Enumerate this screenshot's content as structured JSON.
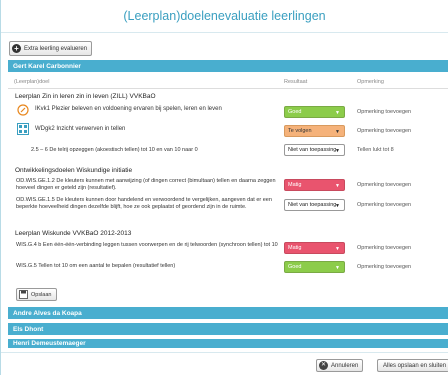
{
  "title": "(Leerplan)doelenevaluatie leerlingen",
  "extra_button": "Extra leerling evalueren",
  "students": [
    "Gert Karel Carbonnier",
    "Andre Alves da Koapa",
    "Els Dhont",
    "Henri Demeustemaeger"
  ],
  "columns": {
    "goal": "(Leerplan)doel",
    "result": "Resultaat",
    "remark": "Opmerking"
  },
  "section1": {
    "title": "Leerplan Zin in leren zin in leven (ZILL) VVKBaO",
    "item1": "IKvk1 Plezier beleven en voldoening ervaren bij spelen, leren en leven",
    "item1_result": "Goed",
    "item1_remark": "Opmerking toevoegen",
    "item2": "WDgk2 Inzicht verwerven in tellen",
    "item2_result": "Te volgen",
    "item2_remark": "Opmerking toevoegen",
    "sub": "2.5 – 6 De telrij opzeggen (akoestisch tellen) tot 10 en van 10 naar 0",
    "sub_result": "Niet van toepassing",
    "sub_remark": "Tellen lukt tot 8"
  },
  "section2": {
    "title": "Ontwikkelingsdoelen Wiskundige initiatie",
    "item1": "OD.WIS.GE.1.2 De kleuters kunnen met aanwijzing (of dingen correct (bimultaan) tellen en daarna zeggen hoeveel dingen er geteld zijn (resultatief).",
    "item1_result": "Matig",
    "item1_remark": "Opmerking toevoegen",
    "item2": "OD.WIS.GE.1.5 De kleuters kunnen door handelend en verwoordend te vergelijken, aangeven dat er een beperkte hoeveelheid dingen dezelfde blijft, hoe ze ook geplaatst of geordend zijn in de ruimte.",
    "item2_result": "Niet van toepassing",
    "item2_remark": "Opmerking toevoegen"
  },
  "section3": {
    "title": "Leerplan Wiskunde VVKBaO 2012-2013",
    "item1": "WIS.G.4 b Een één-één-verbinding leggen tussen voorwerpen en de rij telwoorden (synchroon tellen) tot 10",
    "item1_result": "Matig",
    "item1_remark": "Opmerking toevoegen",
    "item2": "WIS.G.5 Tellen tot 10 om een aantal te bepalen (resultatief tellen)",
    "item2_result": "Goed",
    "item2_remark": "Opmerking toevoegen"
  },
  "save": "Opslaan",
  "footer": {
    "cancel": "Annuleren",
    "save_close": "Alles opslaan en sluiten"
  }
}
